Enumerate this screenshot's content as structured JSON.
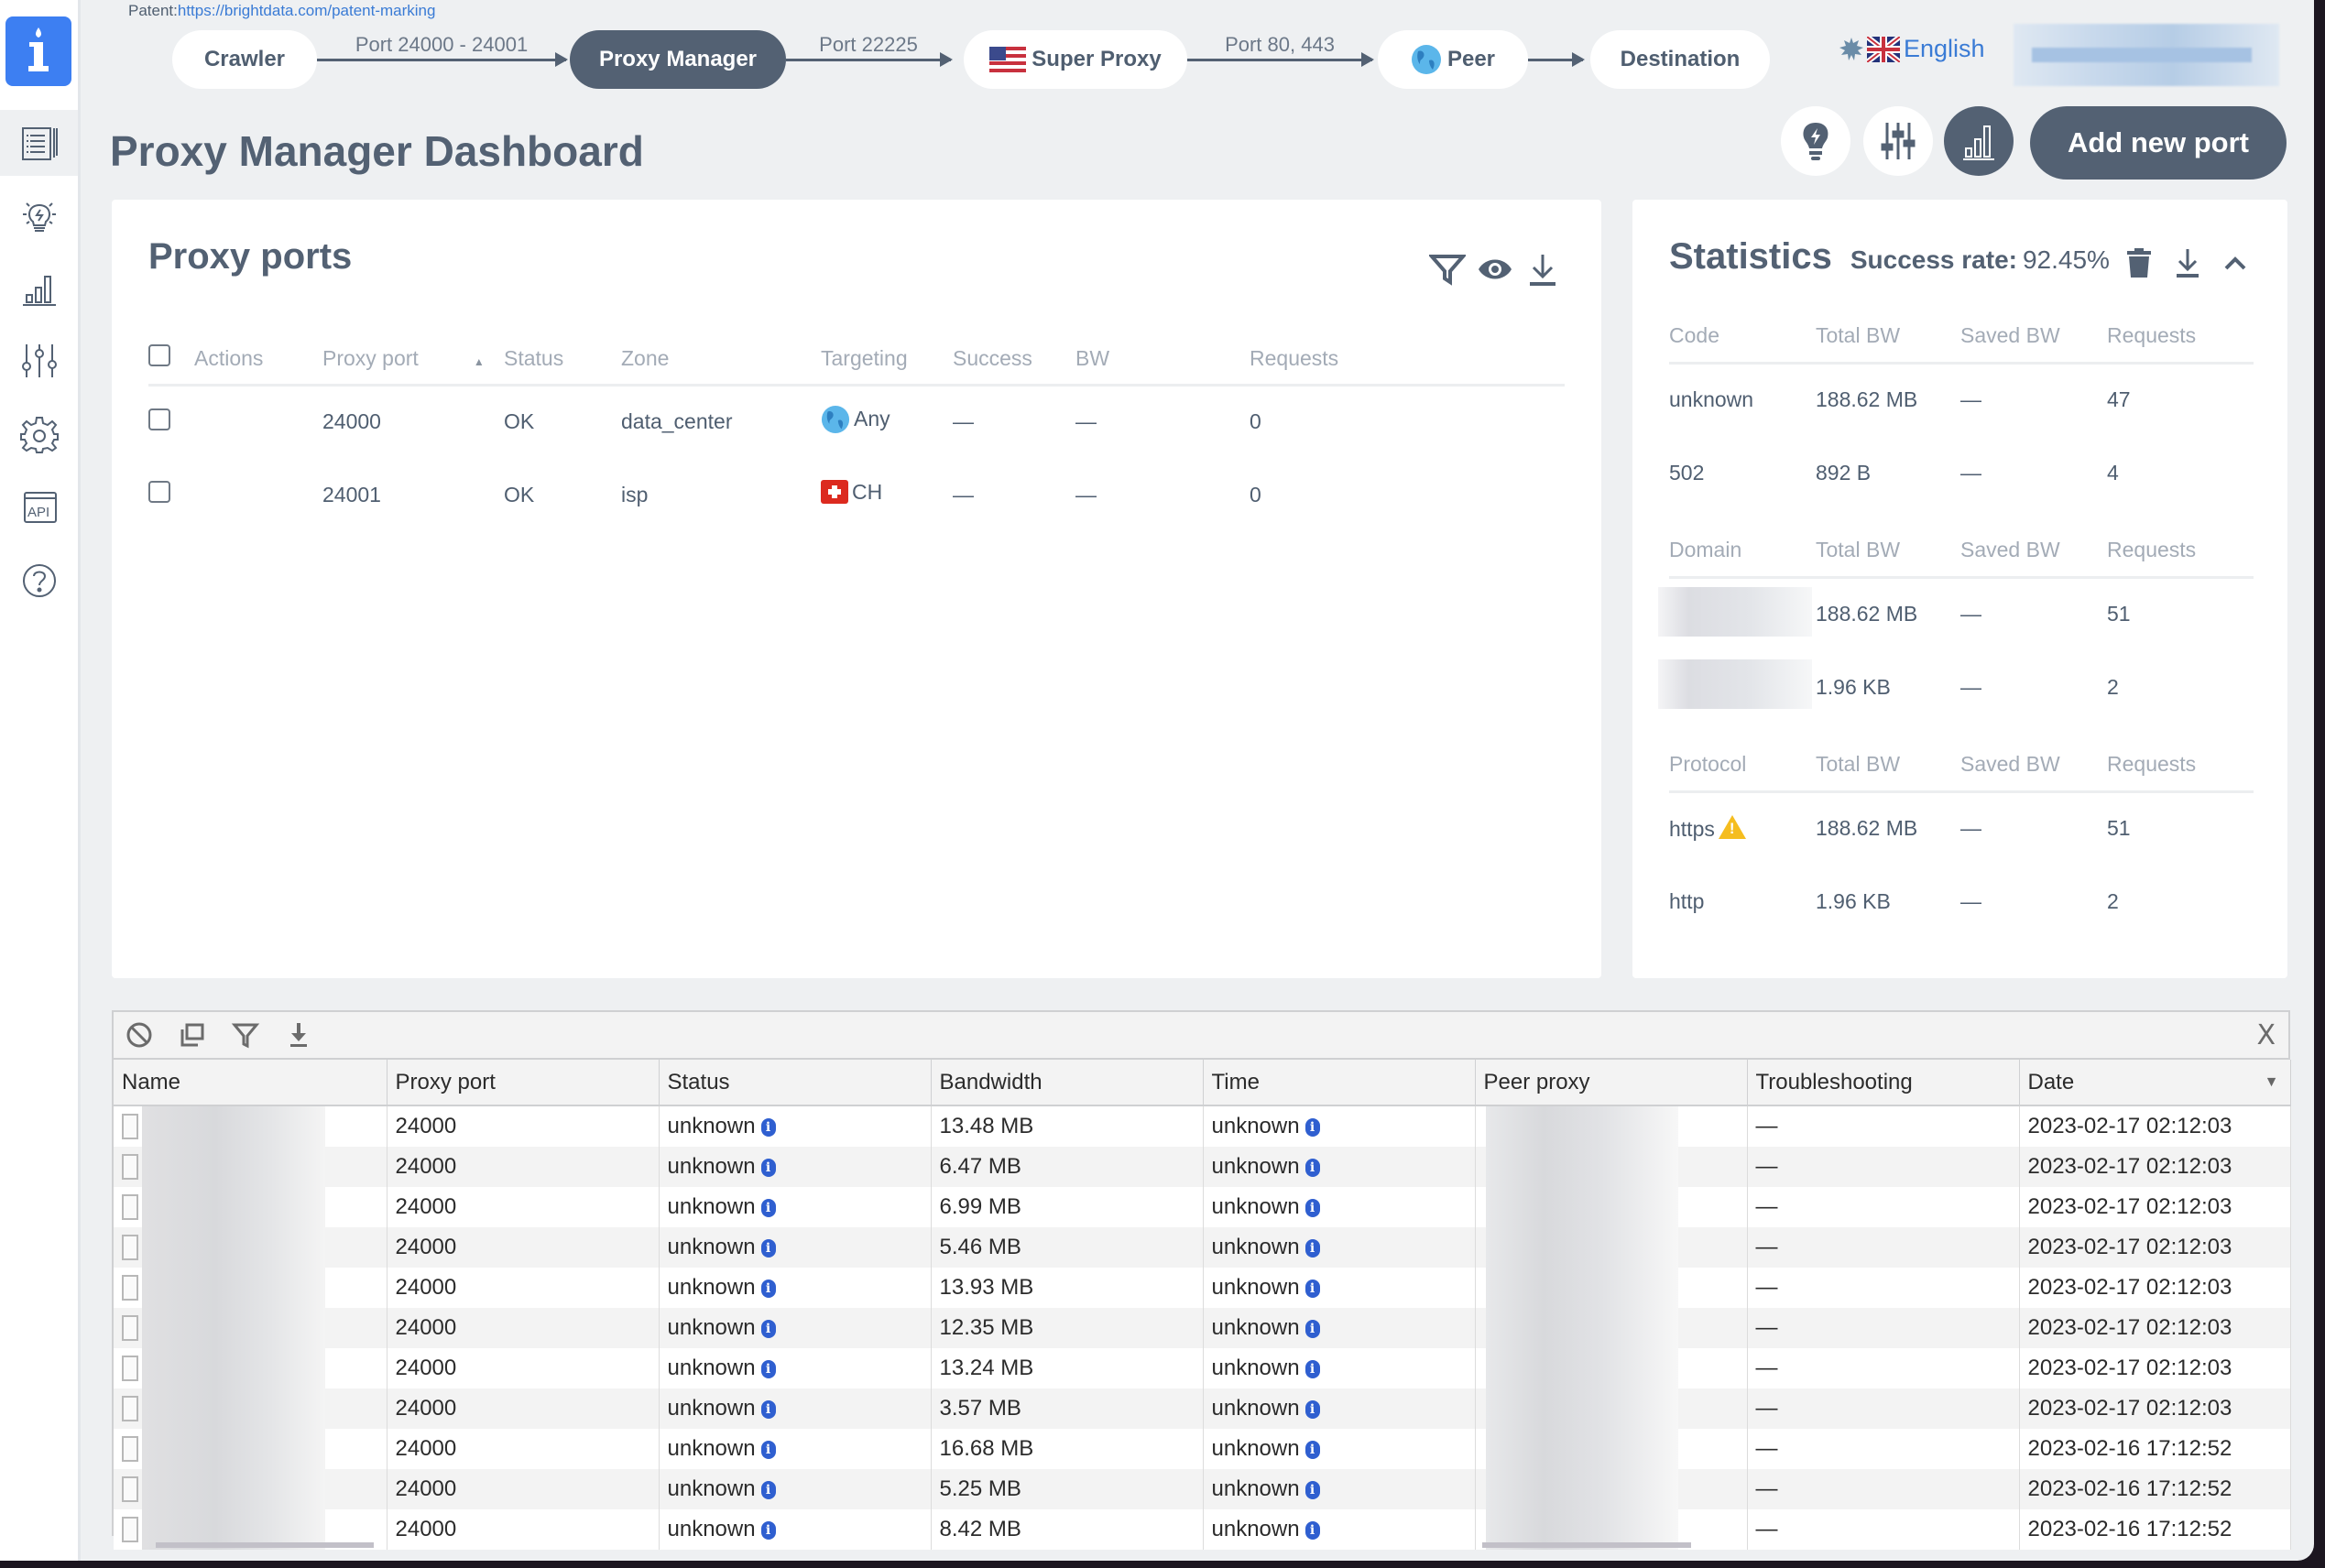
{
  "patent": {
    "label": "Patent:",
    "link": "https://brightdata.com/patent-marking"
  },
  "flow": {
    "nodes": [
      {
        "label": "Crawler",
        "icon": null
      },
      {
        "label": "Proxy Manager",
        "icon": null
      },
      {
        "label": "Super Proxy",
        "icon": "us-flag-icon"
      },
      {
        "label": "Peer",
        "icon": "globe-icon"
      },
      {
        "label": "Destination",
        "icon": null
      }
    ],
    "connectors": [
      "Port 24000 - 24001",
      "Port 22225",
      "Port 80, 443",
      ""
    ]
  },
  "language": {
    "label": "English",
    "icon": "uk-flag-icon"
  },
  "sidebar": {
    "items": [
      {
        "name": "logs",
        "icon": "list-icon",
        "active": true
      },
      {
        "name": "tips",
        "icon": "lightbulb-icon",
        "active": false
      },
      {
        "name": "stats",
        "icon": "bar-chart-icon",
        "active": false
      },
      {
        "name": "config",
        "icon": "sliders-icon",
        "active": false
      },
      {
        "name": "settings",
        "icon": "gear-icon",
        "active": false
      },
      {
        "name": "api",
        "icon": "api-icon",
        "active": false
      },
      {
        "name": "help",
        "icon": "help-icon",
        "active": false
      }
    ]
  },
  "page": {
    "title": "Proxy Manager Dashboard"
  },
  "header_buttons": {
    "add_port": "Add new port"
  },
  "proxy_ports": {
    "title": "Proxy ports",
    "columns": [
      "Actions",
      "Proxy port",
      "Status",
      "Zone",
      "Targeting",
      "Success",
      "BW",
      "Requests"
    ],
    "rows": [
      {
        "port": "24000",
        "status": "OK",
        "zone": "data_center",
        "targeting": "Any",
        "targeting_icon": "globe-icon",
        "success": "—",
        "bw": "—",
        "requests": "0"
      },
      {
        "port": "24001",
        "status": "OK",
        "zone": "isp",
        "targeting": "CH",
        "targeting_icon": "swiss-flag-icon",
        "success": "—",
        "bw": "—",
        "requests": "0"
      }
    ]
  },
  "statistics": {
    "title": "Statistics",
    "success_rate_label": "Success rate:",
    "success_rate": "92.45%",
    "code_table": {
      "columns": [
        "Code",
        "Total BW",
        "Saved BW",
        "Requests"
      ],
      "rows": [
        {
          "key": "unknown",
          "total": "188.62 MB",
          "saved": "—",
          "requests": "47"
        },
        {
          "key": "502",
          "total": "892 B",
          "saved": "—",
          "requests": "4"
        }
      ]
    },
    "domain_table": {
      "columns": [
        "Domain",
        "Total BW",
        "Saved BW",
        "Requests"
      ],
      "rows": [
        {
          "key": "",
          "total": "188.62 MB",
          "saved": "—",
          "requests": "51"
        },
        {
          "key": "",
          "total": "1.96 KB",
          "saved": "—",
          "requests": "2"
        }
      ]
    },
    "protocol_table": {
      "columns": [
        "Protocol",
        "Total BW",
        "Saved BW",
        "Requests"
      ],
      "rows": [
        {
          "key": "https",
          "warning": true,
          "total": "188.62 MB",
          "saved": "—",
          "requests": "51"
        },
        {
          "key": "http",
          "warning": false,
          "total": "1.96 KB",
          "saved": "—",
          "requests": "2"
        }
      ]
    }
  },
  "logs": {
    "close_label": "X",
    "columns": [
      "Name",
      "Proxy port",
      "Status",
      "Bandwidth",
      "Time",
      "Peer proxy",
      "Troubleshooting",
      "Date"
    ],
    "rows": [
      {
        "port": "24000",
        "status": "unknown",
        "bandwidth": "13.48 MB",
        "time": "unknown",
        "troubleshooting": "—",
        "date": "2023-02-17 02:12:03"
      },
      {
        "port": "24000",
        "status": "unknown",
        "bandwidth": "6.47 MB",
        "time": "unknown",
        "troubleshooting": "—",
        "date": "2023-02-17 02:12:03"
      },
      {
        "port": "24000",
        "status": "unknown",
        "bandwidth": "6.99 MB",
        "time": "unknown",
        "troubleshooting": "—",
        "date": "2023-02-17 02:12:03"
      },
      {
        "port": "24000",
        "status": "unknown",
        "bandwidth": "5.46 MB",
        "time": "unknown",
        "troubleshooting": "—",
        "date": "2023-02-17 02:12:03"
      },
      {
        "port": "24000",
        "status": "unknown",
        "bandwidth": "13.93 MB",
        "time": "unknown",
        "troubleshooting": "—",
        "date": "2023-02-17 02:12:03"
      },
      {
        "port": "24000",
        "status": "unknown",
        "bandwidth": "12.35 MB",
        "time": "unknown",
        "troubleshooting": "—",
        "date": "2023-02-17 02:12:03"
      },
      {
        "port": "24000",
        "status": "unknown",
        "bandwidth": "13.24 MB",
        "time": "unknown",
        "troubleshooting": "—",
        "date": "2023-02-17 02:12:03"
      },
      {
        "port": "24000",
        "status": "unknown",
        "bandwidth": "3.57 MB",
        "time": "unknown",
        "troubleshooting": "—",
        "date": "2023-02-17 02:12:03"
      },
      {
        "port": "24000",
        "status": "unknown",
        "bandwidth": "16.68 MB",
        "time": "unknown",
        "troubleshooting": "—",
        "date": "2023-02-16 17:12:52"
      },
      {
        "port": "24000",
        "status": "unknown",
        "bandwidth": "5.25 MB",
        "time": "unknown",
        "troubleshooting": "—",
        "date": "2023-02-16 17:12:52"
      },
      {
        "port": "24000",
        "status": "unknown",
        "bandwidth": "8.42 MB",
        "time": "unknown",
        "troubleshooting": "—",
        "date": "2023-02-16 17:12:52"
      }
    ]
  }
}
